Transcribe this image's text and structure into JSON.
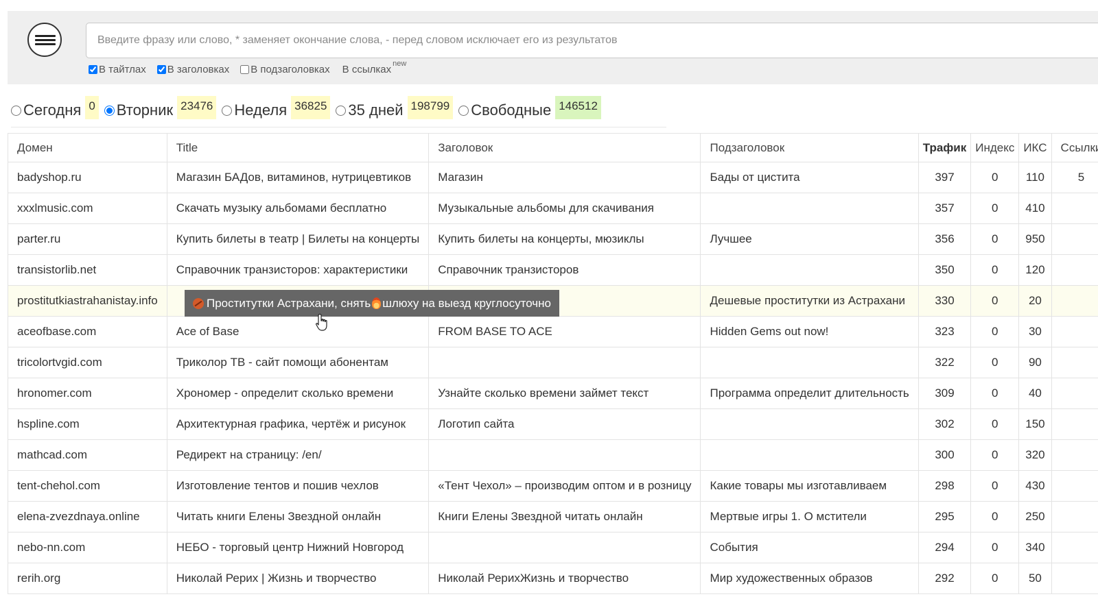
{
  "search": {
    "placeholder": "Введите фразу или слово, * заменяет окончание слова, - перед словом исключает его из результатов",
    "value": ""
  },
  "filters": [
    {
      "label": "В тайтлах",
      "checked": true
    },
    {
      "label": "В заголовках",
      "checked": true
    },
    {
      "label": "В подзаголовках",
      "checked": false
    }
  ],
  "links_filter": {
    "label": "В ссылках",
    "badge": "new"
  },
  "periods": [
    {
      "label": "Сегодня",
      "count": "0",
      "checked": false,
      "tint": "yellow"
    },
    {
      "label": "Вторник",
      "count": "23476",
      "checked": true,
      "tint": "yellow"
    },
    {
      "label": "Неделя",
      "count": "36825",
      "checked": false,
      "tint": "yellow"
    },
    {
      "label": "35 дней",
      "count": "198799",
      "checked": false,
      "tint": "yellow"
    },
    {
      "label": "Свободные",
      "count": "146512",
      "checked": false,
      "tint": "green"
    }
  ],
  "table": {
    "headers": {
      "domain": "Домен",
      "title": "Title",
      "heading": "Заголовок",
      "subheading": "Подзаголовок",
      "traffic": "Трафик",
      "index": "Индекс",
      "iks": "ИКС",
      "links": "Ссылки"
    },
    "rows": [
      {
        "domain": "badyshop.ru",
        "title": "Магазин БАДов, витаминов, нутрицевтиков",
        "heading": "Магазин",
        "subheading": "Бады от цистита",
        "traffic": "397",
        "index": "0",
        "iks": "110",
        "links": "5"
      },
      {
        "domain": "xxxlmusic.com",
        "title": "Скачать музыку альбомами бесплатно",
        "heading": "Музыкальные альбомы для скачивания",
        "subheading": "",
        "traffic": "357",
        "index": "0",
        "iks": "410",
        "links": ""
      },
      {
        "domain": "parter.ru",
        "title": "Купить билеты в театр | Билеты на концерты",
        "heading": "Купить билеты на концерты, мюзиклы",
        "subheading": "Лучшее",
        "traffic": "356",
        "index": "0",
        "iks": "950",
        "links": ""
      },
      {
        "domain": "transistorlib.net",
        "title": "Справочник транзисторов: характеристики",
        "heading": "Справочник транзисторов",
        "subheading": "",
        "traffic": "350",
        "index": "0",
        "iks": "120",
        "links": ""
      },
      {
        "domain": "prostitutkiastrahanistay.info",
        "title": "",
        "heading": "",
        "subheading": "Дешевые проститутки из Астрахани",
        "traffic": "330",
        "index": "0",
        "iks": "20",
        "links": "",
        "highlight": true
      },
      {
        "domain": "aceofbase.com",
        "title": "Ace of Base",
        "heading": "FROM BASE TO ACE",
        "subheading": "Hidden Gems out now!",
        "traffic": "323",
        "index": "0",
        "iks": "30",
        "links": ""
      },
      {
        "domain": "tricolortvgid.com",
        "title": "Триколор ТВ - сайт помощи абонентам",
        "heading": "",
        "subheading": "",
        "traffic": "322",
        "index": "0",
        "iks": "90",
        "links": ""
      },
      {
        "domain": "hronomer.com",
        "title": "Хрономер - определит сколько времени",
        "heading": "Узнайте сколько времени займет текст",
        "subheading": "Программа определит длительность",
        "traffic": "309",
        "index": "0",
        "iks": "40",
        "links": ""
      },
      {
        "domain": "hspline.com",
        "title": "Архитектурная графика, чертёж и рисунок",
        "heading": "Логотип сайта",
        "subheading": "",
        "traffic": "302",
        "index": "0",
        "iks": "150",
        "links": ""
      },
      {
        "domain": "mathcad.com",
        "title": "Редирект на страницу: /en/",
        "heading": "",
        "subheading": "",
        "traffic": "300",
        "index": "0",
        "iks": "320",
        "links": ""
      },
      {
        "domain": "tent-chehol.com",
        "title": "Изготовление тентов и пошив чехлов",
        "heading": "«Тент Чехол» – производим оптом и в розницу",
        "subheading": "Какие товары мы изготавливаем",
        "traffic": "298",
        "index": "0",
        "iks": "430",
        "links": ""
      },
      {
        "domain": "elena-zvezdnaya.online",
        "title": "Читать книги Елены Звездной онлайн",
        "heading": "Книги Елены Звездной читать онлайн",
        "subheading": "Мертвые игры 1. О мстители",
        "traffic": "295",
        "index": "0",
        "iks": "250",
        "links": ""
      },
      {
        "domain": "nebo-nn.com",
        "title": "НЕБО - торговый центр Нижний Новгород",
        "heading": "",
        "subheading": "События",
        "traffic": "294",
        "index": "0",
        "iks": "340",
        "links": ""
      },
      {
        "domain": "rerih.org",
        "title": "Николай Рерих | Жизнь и творчество",
        "heading": "Николай РерихЖизнь и творчество",
        "subheading": "Мир художественных образов",
        "traffic": "292",
        "index": "0",
        "iks": "50",
        "links": ""
      }
    ]
  },
  "tooltip": {
    "text_a": "Проститутки Астрахани, снять ",
    "text_b": "шлюху на выезд круглосуточно"
  }
}
